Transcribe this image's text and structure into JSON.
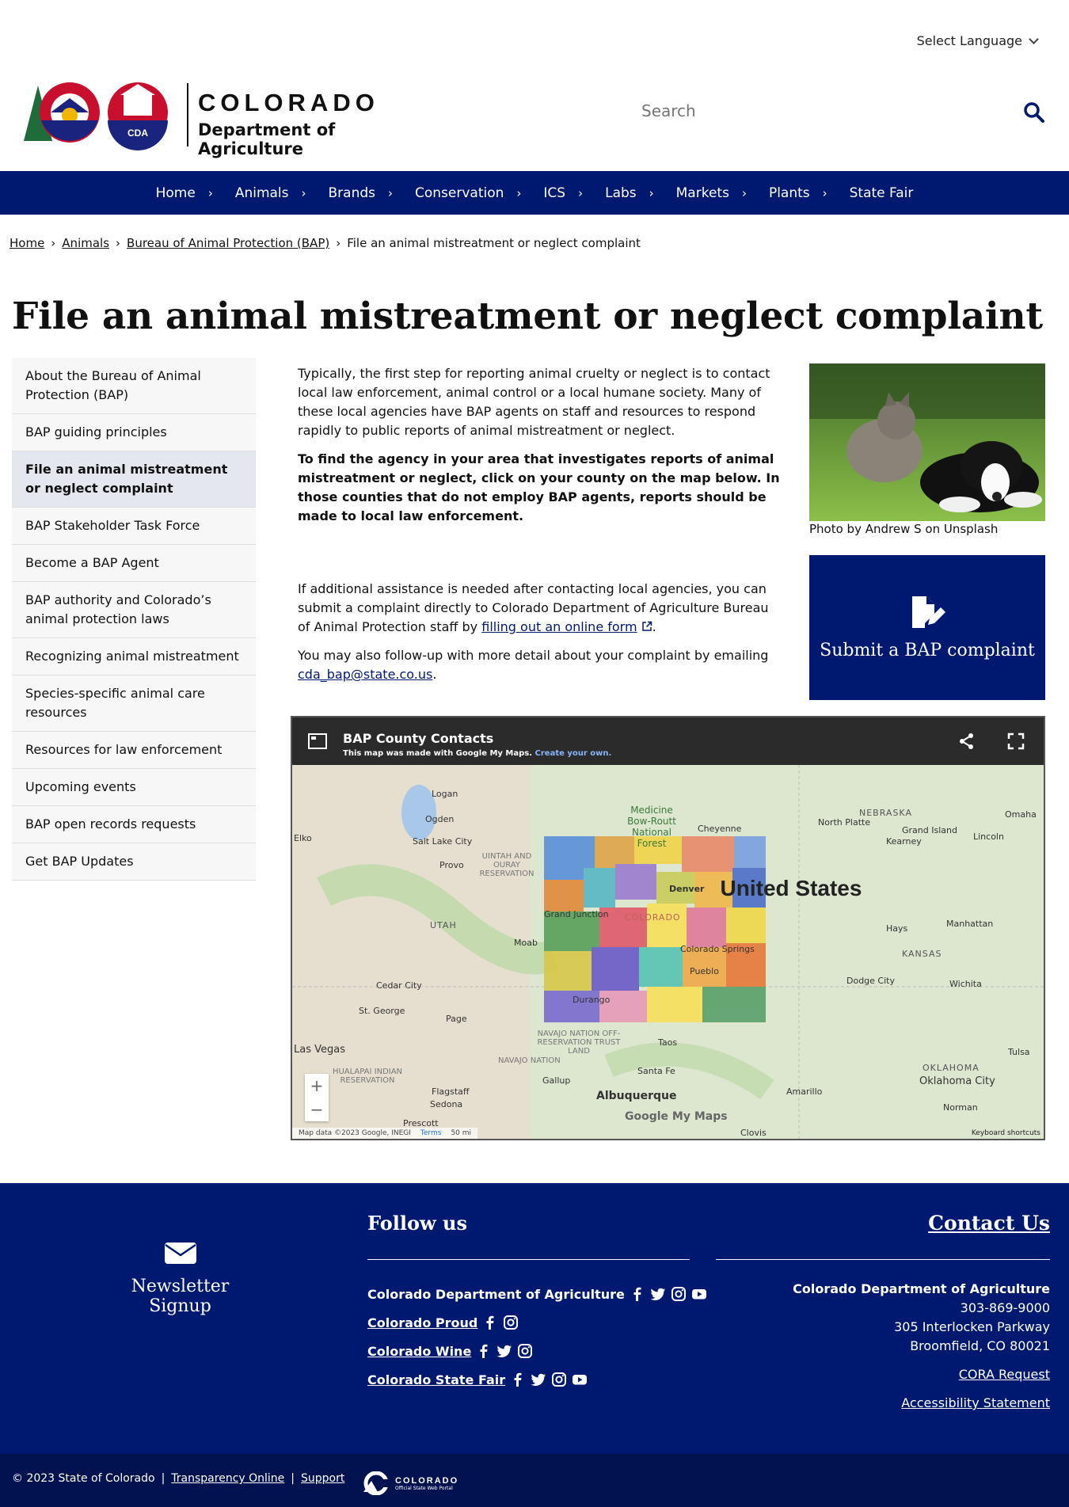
{
  "header": {
    "language_label": "Select Language",
    "logo_line1": "COLORADO",
    "logo_line2": "Department of Agriculture",
    "search_placeholder": "Search"
  },
  "nav": {
    "items": [
      {
        "label": "Home"
      },
      {
        "label": "Animals"
      },
      {
        "label": "Brands"
      },
      {
        "label": "Conservation"
      },
      {
        "label": "ICS"
      },
      {
        "label": "Labs"
      },
      {
        "label": "Markets"
      },
      {
        "label": "Plants"
      },
      {
        "label": "State Fair"
      }
    ]
  },
  "breadcrumb": {
    "items": [
      "Home",
      "Animals",
      "Bureau of Animal Protection (BAP)"
    ],
    "current": "File an animal mistreatment or neglect complaint",
    "separator": "›"
  },
  "page_title": "File an animal mistreatment or neglect complaint",
  "sidebar": {
    "items": [
      {
        "label": "About the Bureau of Animal Protection (BAP)"
      },
      {
        "label": "BAP guiding principles"
      },
      {
        "label": "File an animal mistreatment or neglect complaint",
        "active": true
      },
      {
        "label": "BAP Stakeholder Task Force"
      },
      {
        "label": "Become a BAP Agent"
      },
      {
        "label": "BAP authority and Colorado’s animal protection laws"
      },
      {
        "label": "Recognizing animal mistreatment"
      },
      {
        "label": "Species-specific animal care resources"
      },
      {
        "label": "Resources for law enforcement"
      },
      {
        "label": "Upcoming events"
      },
      {
        "label": "BAP open records requests"
      },
      {
        "label": "Get BAP Updates"
      }
    ]
  },
  "main": {
    "para1": "Typically, the first step for reporting animal cruelty or neglect is to contact local law enforcement, animal control or a local humane society. Many of these local agencies have BAP agents on staff and resources to respond rapidly to public reports of animal mistreatment or neglect.",
    "para2": "To find the agency in your area that investigates reports of animal mistreatment or neglect, click on your county on the map below. In those counties that do not employ BAP agents, reports should be made to local law enforcement.",
    "para3_before": "If additional assistance is needed after contacting local agencies, you can submit a complaint directly to Colorado Department of Agriculture Bureau of Animal Protection staff by ",
    "para3_link": "filling out an online form",
    "para3_after": ".",
    "para4_before": "You may also follow-up with more detail about your complaint by emailing ",
    "para4_link": "cda_bap@state.co.us",
    "para4_after": ".",
    "photo_caption": "Photo by Andrew S on Unsplash",
    "cta_label": "Submit a BAP complaint"
  },
  "map": {
    "title": "BAP County Contacts",
    "subtitle": "This map was made with Google My Maps.",
    "subtitle_link": "Create your own.",
    "country_label": "United States",
    "states": [
      "UTAH",
      "COLORADO",
      "KANSAS",
      "NEBRASKA",
      "OKLAHOMA"
    ],
    "cities": [
      "Logan",
      "Ogden",
      "Salt Lake City",
      "Provo",
      "Elko",
      "Cheyenne",
      "North Platte",
      "Grand Island",
      "Kearney",
      "Lincoln",
      "Omaha",
      "Denver",
      "Grand Junction",
      "Moab",
      "Colorado Springs",
      "Pueblo",
      "Durango",
      "Hays",
      "Manhattan",
      "Wichita",
      "Dodge City",
      "Cedar City",
      "St. George",
      "Page",
      "Las Vegas",
      "Taos",
      "Santa Fe",
      "Gallup",
      "Albuquerque",
      "Flagstaff",
      "Sedona",
      "Prescott",
      "Amarillo",
      "Clovis",
      "Oklahoma City",
      "Norman",
      "Tulsa"
    ],
    "regions": [
      "Medicine Bow-Routt National Forest",
      "UINTAH AND OURAY RESERVATION",
      "NAVAJO NATION OFF-RESERVATION TRUST LAND",
      "NAVAJO NATION",
      "HUALAPAI INDIAN RESERVATION"
    ],
    "attribution": "Map data ©2023 Google, INEGI",
    "terms": "Terms",
    "scale": "50 mi",
    "shortcuts": "Keyboard shortcuts",
    "brand": "Google My Maps",
    "zoom_in": "+",
    "zoom_out": "−"
  },
  "footer": {
    "newsletter_label": "Newsletter Signup",
    "follow_title": "Follow us",
    "follow_rows": [
      {
        "label": "Colorado Department of Agriculture",
        "icons": [
          "facebook-icon",
          "twitter-icon",
          "instagram-icon",
          "youtube-icon"
        ]
      },
      {
        "label": "Colorado Proud",
        "icons": [
          "facebook-icon",
          "instagram-icon"
        ]
      },
      {
        "label": "Colorado Wine",
        "icons": [
          "facebook-icon",
          "twitter-icon",
          "instagram-icon"
        ]
      },
      {
        "label": "Colorado State Fair",
        "icons": [
          "facebook-icon",
          "twitter-icon",
          "instagram-icon",
          "youtube-icon"
        ]
      }
    ],
    "contact_title": "Contact Us",
    "contact_org": "Colorado Department of Agriculture",
    "contact_phone": "303-869-9000",
    "contact_addr1": "305 Interlocken Parkway",
    "contact_addr2": "Broomfield, CO 80021",
    "cora_link": "CORA Request",
    "accessibility_link": "Accessibility Statement"
  },
  "subfooter": {
    "copyright": "© 2023 State of Colorado",
    "separator": "|",
    "transparency": "Transparency Online",
    "support": "Support",
    "logo_line1": "COLORADO",
    "logo_line2": "Official State Web Portal"
  },
  "colors": {
    "brand_navy": "#001970",
    "subfooter_navy": "#00124f"
  }
}
